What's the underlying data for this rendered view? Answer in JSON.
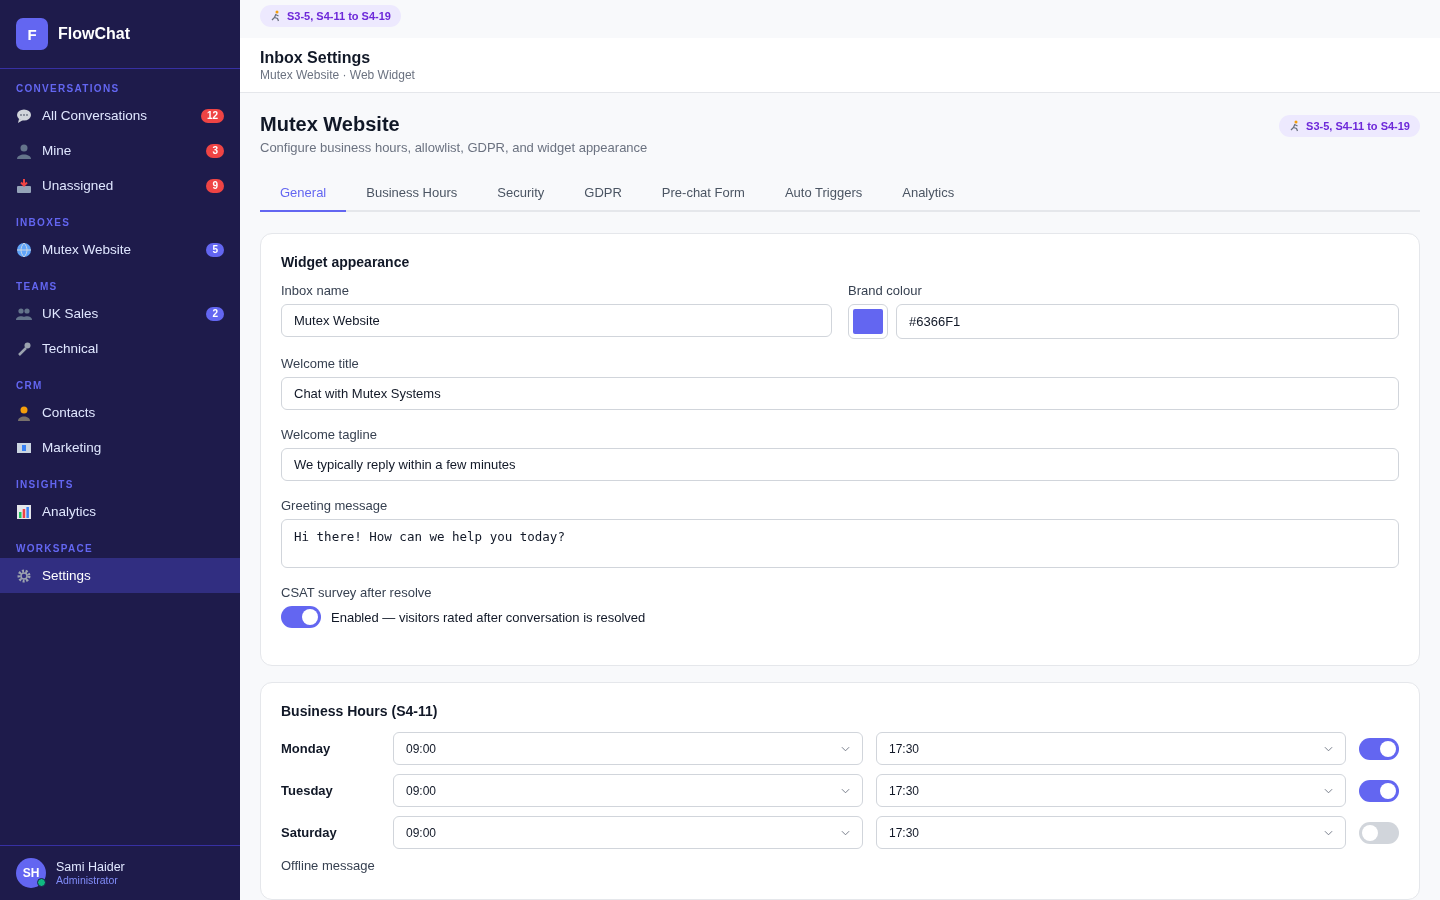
{
  "brand": {
    "initial": "F",
    "name": "FlowChat"
  },
  "sidebar": {
    "sections": [
      {
        "title": "CONVERSATIONS",
        "items": [
          {
            "label": "All Conversations",
            "count": "12",
            "color": "#ef4444",
            "selected": false
          },
          {
            "label": "Mine",
            "count": "3",
            "color": "#ef4444",
            "selected": false
          },
          {
            "label": "Unassigned",
            "count": "9",
            "color": "#ef4444",
            "selected": false
          }
        ]
      },
      {
        "title": "INBOXES",
        "items": [
          {
            "label": "Mutex Website",
            "count": "5",
            "color": "#6366f1",
            "selected": false
          }
        ]
      },
      {
        "title": "TEAMS",
        "items": [
          {
            "label": "UK Sales",
            "count": "2",
            "color": "#6366f1",
            "selected": false
          },
          {
            "label": "Technical",
            "selected": false
          }
        ]
      },
      {
        "title": "CRM",
        "items": [
          {
            "label": "Contacts",
            "selected": false
          },
          {
            "label": "Marketing",
            "selected": false
          }
        ]
      },
      {
        "title": "INSIGHTS",
        "items": [
          {
            "label": "Analytics",
            "selected": false
          }
        ]
      },
      {
        "title": "WORKSPACE",
        "items": [
          {
            "label": "Settings",
            "selected": true
          }
        ]
      }
    ]
  },
  "user": {
    "initials": "SH",
    "name": "Sami Haider",
    "role": "Administrator",
    "online": true
  },
  "top_badge": "S3-5, S4-11 to S4-19",
  "header": {
    "title": "Inbox Settings",
    "subtitle": "Mutex Website · Web Widget"
  },
  "page": {
    "title": "Mutex Website",
    "description": "Configure business hours, allowlist, GDPR, and widget appearance",
    "badge": "S3-5, S4-11 to S4-19"
  },
  "tabs": [
    {
      "label": "General",
      "selected": true
    },
    {
      "label": "Business Hours",
      "selected": false
    },
    {
      "label": "Security",
      "selected": false
    },
    {
      "label": "GDPR",
      "selected": false
    },
    {
      "label": "Pre-chat Form",
      "selected": false
    },
    {
      "label": "Auto Triggers",
      "selected": false
    },
    {
      "label": "Analytics",
      "selected": false
    }
  ],
  "widget": {
    "title": "Widget appearance",
    "inbox_name": {
      "label": "Inbox name",
      "value": "Mutex Website"
    },
    "brand_colour": {
      "label": "Brand colour",
      "value": "#6366F1",
      "color": "#6366f1"
    },
    "welcome_title": {
      "label": "Welcome title",
      "value": "Chat with Mutex Systems"
    },
    "welcome_tagline": {
      "label": "Welcome tagline",
      "value": "We typically reply within a few minutes"
    },
    "greeting": {
      "label": "Greeting message",
      "value": "Hi there! How can we help you today?"
    },
    "csat": {
      "label": "CSAT survey after resolve",
      "on": true,
      "text": "Enabled — visitors rated after conversation is resolved"
    }
  },
  "hours": {
    "title": "Business Hours (S4-11)",
    "days": [
      {
        "day": "Monday",
        "open": "09:00",
        "close": "17:30",
        "on": true
      },
      {
        "day": "Tuesday",
        "open": "09:00",
        "close": "17:30",
        "on": true
      },
      {
        "day": "Saturday",
        "open": "09:00",
        "close": "17:30",
        "on": false
      }
    ],
    "offline_label": "Offline message"
  }
}
